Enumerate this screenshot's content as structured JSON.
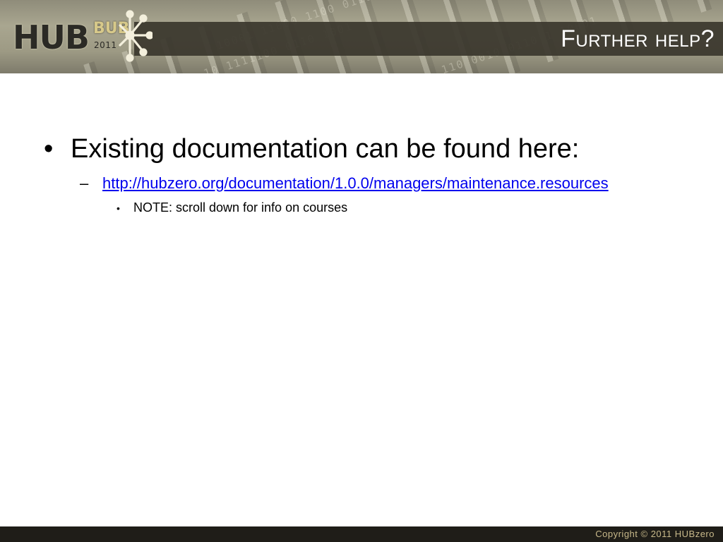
{
  "header": {
    "title": "Further help?"
  },
  "logo": {
    "main": "HUB",
    "sub": "BUB",
    "year": "2011",
    "icon": "starburst-icon"
  },
  "content": {
    "bullet": "Existing documentation can be found here:",
    "link_text": "http://hubzero.org/documentation/1.0.0/managers/maintenance.resources",
    "note": "NOTE: scroll down for info on courses"
  },
  "footer": {
    "copyright": "Copyright  ©  2011  HUBzero"
  },
  "colors": {
    "title_band": "#3a362c",
    "footer_bg": "#1f1d18",
    "footer_text": "#c8b98a",
    "link": "#0000ee"
  }
}
